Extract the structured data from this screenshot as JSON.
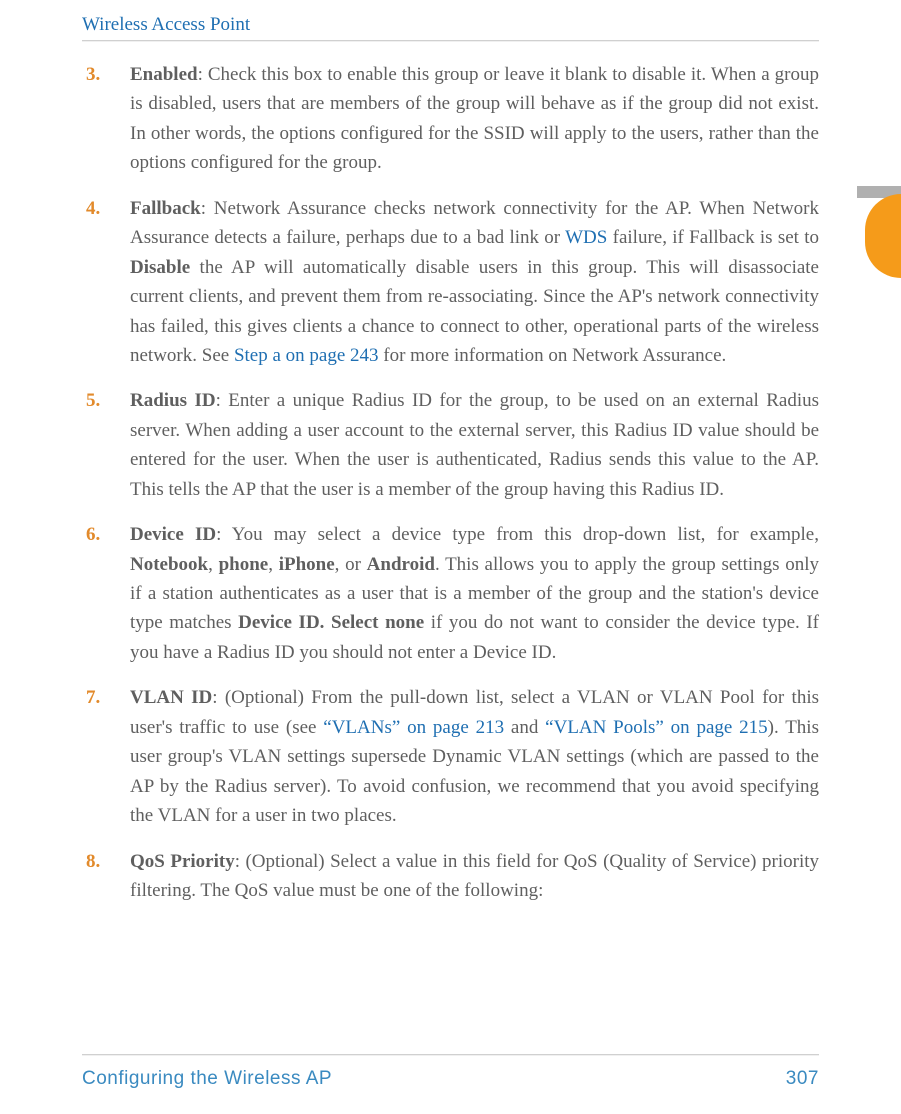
{
  "header": {
    "running": "Wireless Access Point"
  },
  "items": [
    {
      "n": "3.",
      "html": "<b>Enabled</b>: Check this box to enable this group or leave it blank to disable it. When a group is disabled, users that are members of the group will behave as if the group did not exist. In other words, the options configured for the SSID will apply to the users, rather than the options configured for the group."
    },
    {
      "n": "4.",
      "html": "<b>Fallback</b>: Network Assurance checks network connectivity for the AP. When Network Assurance detects a failure, perhaps due to a bad link or <span class=\"link\">WDS</span> failure, if Fallback is set to <b>Disable</b> the AP will automatically disable users in this group. This will disassociate current clients, and prevent them from re-associating. Since the AP's network connectivity has failed, this gives clients a chance to connect to other, operational parts of the wireless network. See <span class=\"link\">Step a on page 243</span> for more information on Network Assurance."
    },
    {
      "n": "5.",
      "html": "<b>Radius ID</b>: Enter a unique Radius ID for the group, to be used on an external Radius server. When adding a user account to the external server, this Radius ID value should be entered for the user. When the user is authenticated, Radius sends this value to the AP. This tells the AP that the user is a member of the group having this Radius ID."
    },
    {
      "n": "6.",
      "html": "<b>Device ID</b>: You may select a device type from this drop-down list, for example, <b>Notebook</b>, <b>phone</b>, <b>iPhone</b>, or <b>Android</b>. This allows you to apply the group settings only if a station authenticates as a user that is a member of the group and the station's device type matches <b>Device ID. Select none</b> if you do not want to consider the device type. If you have a Radius ID you should not enter a Device ID."
    },
    {
      "n": "7.",
      "html": "<b>VLAN ID</b>: (Optional) From the pull-down list, select a VLAN or VLAN Pool for this user's traffic to use (see <span class=\"link\">“VLANs” on page 213</span> and <span class=\"link\">“VLAN Pools” on page 215</span>). This user group's VLAN settings supersede Dynamic VLAN settings (which are passed to the AP by the Radius server). To avoid confusion, we recommend that you avoid specifying the VLAN for a user in two places."
    },
    {
      "n": "8.",
      "html": "<b>QoS Priority</b>: (Optional) Select a value in this field for QoS (Quality of Service) priority filtering. The QoS value must be one of the following:"
    }
  ],
  "footer": {
    "left": "Configuring the Wireless AP",
    "right": "307"
  }
}
